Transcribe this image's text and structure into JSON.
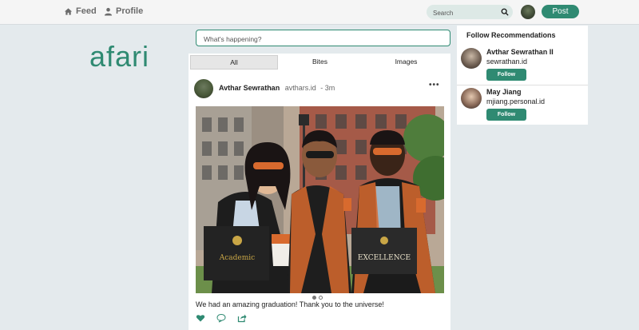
{
  "nav": {
    "feed_label": "Feed",
    "profile_label": "Profile",
    "search_placeholder": "Search",
    "post_button": "Post"
  },
  "logo_text": "afari",
  "compose": {
    "placeholder": "What's happening?"
  },
  "tabs": [
    {
      "label": "All",
      "active": true
    },
    {
      "label": "Bites",
      "active": false
    },
    {
      "label": "Images",
      "active": false
    }
  ],
  "post": {
    "author": "Avthar Sewrathan",
    "handle": "avthars.id",
    "time": "- 3m",
    "more_icon": "more-horizontal-icon",
    "caption": "We had an amazing graduation! Thank you to the universe!",
    "carousel": {
      "count": 2,
      "active": 1
    },
    "actions": [
      "heart-icon",
      "comment-icon",
      "share-icon"
    ]
  },
  "recommendations": {
    "title": "Follow Recommendations",
    "items": [
      {
        "name": "Avthar Sewrathan II",
        "handle": "sewrathan.id",
        "button": "Follow"
      },
      {
        "name": "May Jiang",
        "handle": "mjiang.personal.id",
        "button": "Follow"
      }
    ]
  },
  "colors": {
    "accent": "#2f8a72",
    "background": "#e4eaed",
    "topbar": "#f5f5f5"
  }
}
